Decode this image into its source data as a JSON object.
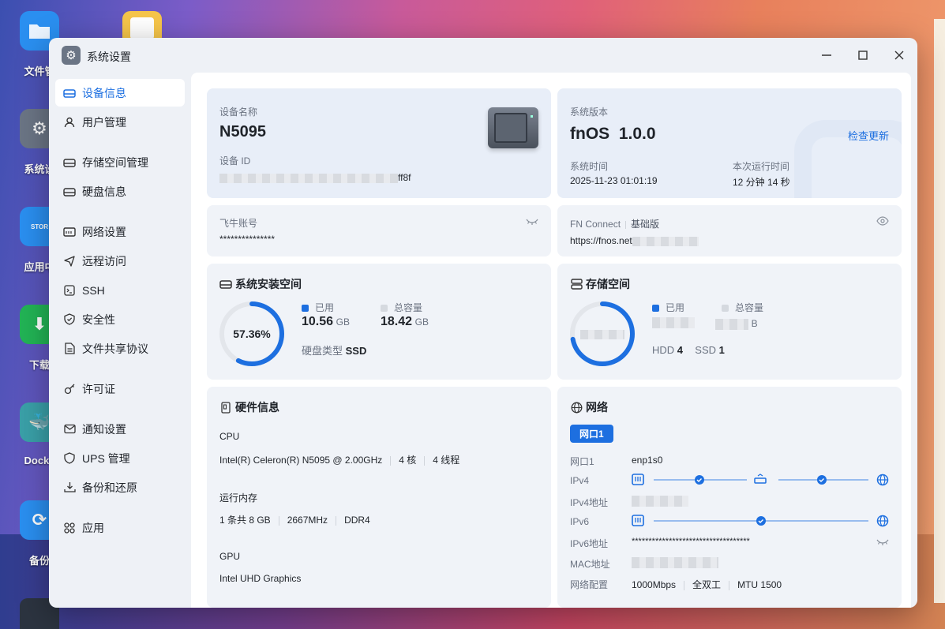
{
  "desktop": {
    "icons": [
      {
        "label": "文件管"
      },
      {
        "label": "系统设"
      },
      {
        "label": "应用中"
      },
      {
        "label": "下载"
      },
      {
        "label": "Docke"
      },
      {
        "label": "备份"
      }
    ],
    "storage_icon_text": "STOR"
  },
  "window": {
    "title": "系统设置",
    "minimize": "—",
    "maximize": "☐",
    "close": "✕"
  },
  "sidebar": {
    "items": [
      {
        "label": "设备信息",
        "icon": "drive-icon"
      },
      {
        "label": "用户管理",
        "icon": "user-icon"
      },
      {
        "label": "存储空间管理",
        "icon": "storage-icon"
      },
      {
        "label": "硬盘信息",
        "icon": "disk-icon"
      },
      {
        "label": "网络设置",
        "icon": "network-icon"
      },
      {
        "label": "远程访问",
        "icon": "send-icon"
      },
      {
        "label": "SSH",
        "icon": "terminal-icon"
      },
      {
        "label": "安全性",
        "icon": "shield-icon"
      },
      {
        "label": "文件共享协议",
        "icon": "file-icon"
      },
      {
        "label": "许可证",
        "icon": "key-icon"
      },
      {
        "label": "通知设置",
        "icon": "mail-icon"
      },
      {
        "label": "UPS 管理",
        "icon": "shield-outline-icon"
      },
      {
        "label": "备份和还原",
        "icon": "backup-icon"
      },
      {
        "label": "应用",
        "icon": "apps-icon"
      }
    ]
  },
  "device": {
    "name_label": "设备名称",
    "name": "N5095",
    "id_label": "设备 ID",
    "id_suffix": "ff8f"
  },
  "system": {
    "version_label": "系统版本",
    "version": "fnOS  1.0.0",
    "check_update": "检查更新",
    "time_label": "系统时间",
    "time": "2025-11-23 01:01:19",
    "uptime_label": "本次运行时间",
    "uptime": "12 分钟 14 秒"
  },
  "account": {
    "label": "飞牛账号",
    "value": "***************"
  },
  "fnconnect": {
    "label": "FN Connect",
    "edition": "基础版",
    "url": "https://fnos.net"
  },
  "sys_space": {
    "title": "系统安装空间",
    "percent_text": "57.36%",
    "percent": 57.36,
    "used_label": "已用",
    "used_value": "10.56",
    "used_unit": "GB",
    "total_label": "总容量",
    "total_value": "18.42",
    "total_unit": "GB",
    "disk_type_label": "硬盘类型",
    "disk_type": "SSD",
    "used_color": "#1d6fe0",
    "track_color": "#e3e6eb"
  },
  "storage": {
    "title": "存储空间",
    "used_label": "已用",
    "total_label": "总容量",
    "total_unit": "B",
    "hdd_label": "HDD",
    "hdd_count": "4",
    "ssd_label": "SSD",
    "ssd_count": "1",
    "percent": 72
  },
  "hardware": {
    "title": "硬件信息",
    "cpu_label": "CPU",
    "cpu_model": "Intel(R) Celeron(R) N5095 @ 2.00GHz",
    "cpu_cores": "4 核",
    "cpu_threads": "4 线程",
    "ram_label": "运行内存",
    "ram_modules": "1 条共 8 GB",
    "ram_freq": "2667MHz",
    "ram_type": "DDR4",
    "gpu_label": "GPU",
    "gpu_model": "Intel UHD Graphics"
  },
  "network": {
    "title": "网络",
    "tab": "网口1",
    "port_label": "网口1",
    "port_value": "enp1s0",
    "ipv4_label": "IPv4",
    "ipv4_addr_label": "IPv4地址",
    "ipv6_label": "IPv6",
    "ipv6_addr_label": "IPv6地址",
    "ipv6_addr": "***********************************",
    "mac_label": "MAC地址",
    "config_label": "网络配置",
    "speed": "1000Mbps",
    "duplex": "全双工",
    "mtu": "MTU 1500",
    "accent": "#1d6fe0"
  }
}
